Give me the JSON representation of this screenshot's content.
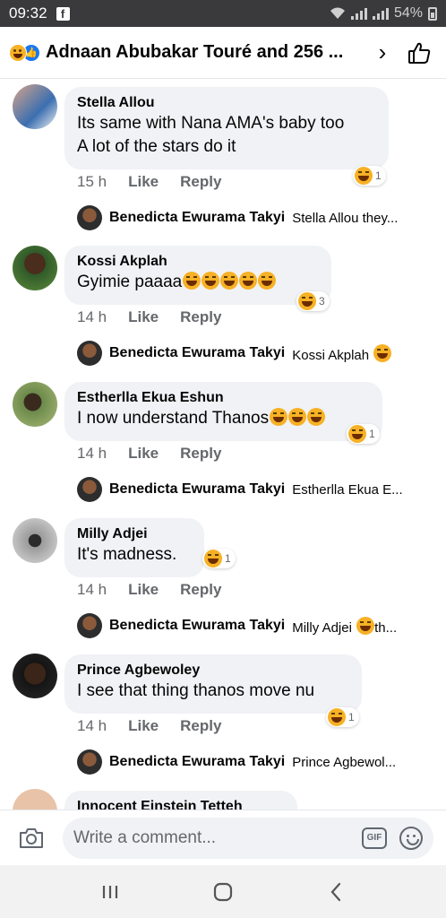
{
  "status_bar": {
    "time": "09:32",
    "battery": "54%"
  },
  "header": {
    "title": "Adnaan Abubakar Touré and 256 ...",
    "chevron": "›"
  },
  "comments": [
    {
      "name": "Stella Allou",
      "text": "Its same with Nana AMA's baby too\nA lot of the stars do it",
      "time": "15 h",
      "like": "Like",
      "reply": "Reply",
      "reactions": "1",
      "reply_preview": {
        "name": "Benedicta Ewurama Takyi",
        "text": "Stella Allou they..."
      }
    },
    {
      "name": "Kossi Akplah",
      "text": "Gyimie paaaa",
      "time": "14 h",
      "like": "Like",
      "reply": "Reply",
      "reactions": "3",
      "reply_preview": {
        "name": "Benedicta Ewurama Takyi",
        "text": "Kossi Akplah"
      }
    },
    {
      "name": "Estherlla Ekua Eshun",
      "text": "I now understand Thanos",
      "time": "14 h",
      "like": "Like",
      "reply": "Reply",
      "reactions": "1",
      "reply_preview": {
        "name": "Benedicta Ewurama Takyi",
        "text": "Estherlla Ekua E..."
      }
    },
    {
      "name": "Milly Adjei",
      "text": "It's madness.",
      "time": "14 h",
      "like": "Like",
      "reply": "Reply",
      "reactions": "1",
      "reply_preview": {
        "name": "Benedicta Ewurama Takyi",
        "text": "Milly Adjei",
        "tail": "th..."
      }
    },
    {
      "name": "Prince Agbewoley",
      "text": "I see that thing thanos move nu",
      "time": "14 h",
      "like": "Like",
      "reply": "Reply",
      "reactions": "1",
      "reply_preview": {
        "name": "Benedicta Ewurama Takyi",
        "text": "Prince Agbewol..."
      }
    },
    {
      "name": "Innocent Einstein Tetteh"
    }
  ],
  "composer": {
    "placeholder": "Write a comment...",
    "gif_label": "GIF"
  },
  "colors": {
    "bubble": "#f0f2f5",
    "meta": "#65676b",
    "like_blue": "#1877f2",
    "haha": "#f7b125"
  }
}
